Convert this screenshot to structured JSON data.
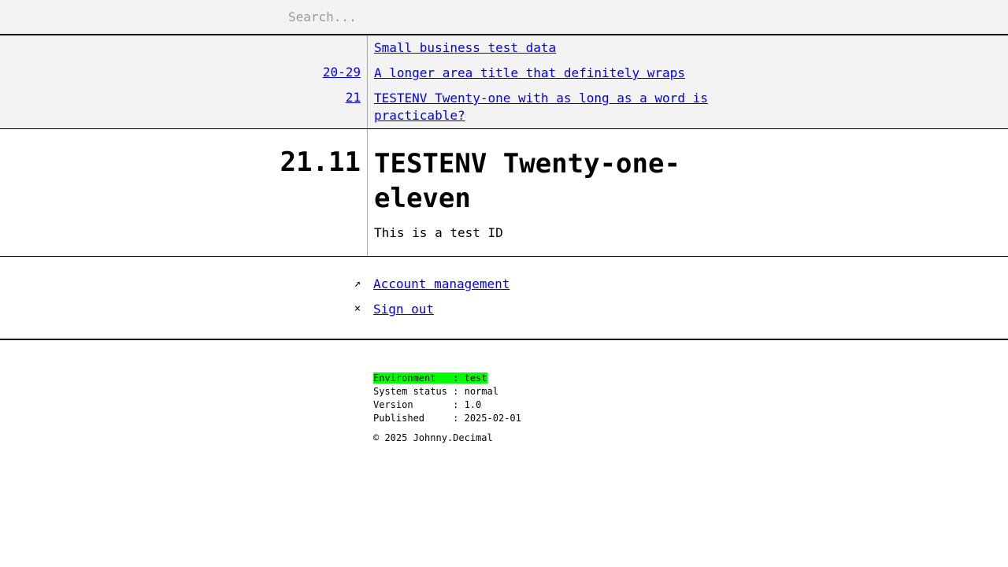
{
  "search": {
    "placeholder": "Search..."
  },
  "breadcrumbs": [
    {
      "number": "",
      "title": "Small business test data"
    },
    {
      "number": "20-29",
      "title": "A longer area title that definitely wraps"
    },
    {
      "number": "21",
      "title": "TESTENV Twenty-one with as long as a word is practicable?"
    }
  ],
  "main": {
    "id": "21.11",
    "title": "TESTENV Twenty-one-eleven",
    "description": "This is a test ID"
  },
  "account": {
    "items": [
      {
        "icon": "↗",
        "label": "Account management"
      },
      {
        "icon": "×",
        "label": "Sign out"
      }
    ]
  },
  "footer": {
    "environment": "Environment   : test",
    "system_status": "System status : normal",
    "version": "Version       : 1.0",
    "published": "Published     : 2025-02-01",
    "copyright": "© 2025 Johnny.Decimal",
    "env_highlight_color": "#00ff00"
  }
}
